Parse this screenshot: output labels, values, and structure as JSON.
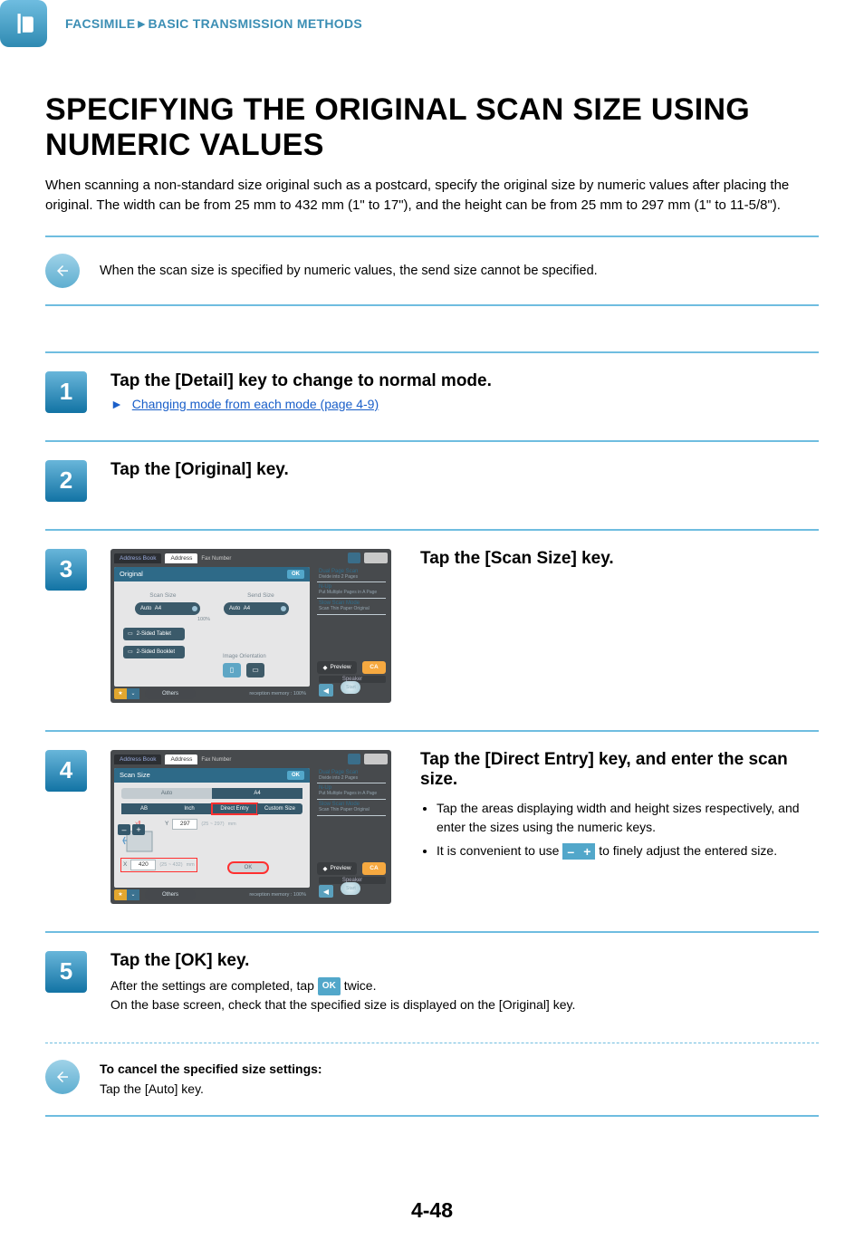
{
  "header": {
    "breadcrumb": "FACSIMILE►BASIC TRANSMISSION METHODS"
  },
  "title": "SPECIFYING THE ORIGINAL SCAN SIZE USING NUMERIC VALUES",
  "intro": "When scanning a non-standard size original such as a postcard, specify the original size by numeric values after placing the original. The width can be from 25 mm to 432 mm (1\" to 17\"), and the height can be from 25 mm to 297 mm (1\" to 11-5/8\").",
  "note": "When the scan size is specified by numeric values, the send size cannot be specified.",
  "steps": {
    "s1": {
      "num": "1",
      "title": "Tap the [Detail] key to change to normal mode.",
      "link": "Changing mode from each mode (page 4-9)"
    },
    "s2": {
      "num": "2",
      "title": "Tap the [Original] key."
    },
    "s3": {
      "num": "3",
      "title": "Tap the [Scan Size] key.",
      "ss": {
        "addressBook": "Address Book",
        "tabAddress": "Address",
        "tabFax": "Fax Number",
        "panelTitle": "Original",
        "ok": "OK",
        "scanSizeLabel": "Scan Size",
        "sendSizeLabel": "Send Size",
        "ratio": "100%",
        "pillAuto": "Auto",
        "pillA4": "A4",
        "twosidedTablet": "2-Sided Tablet",
        "twosidedBooklet": "2-Sided Booklet",
        "imageOrientation": "Image Orientation",
        "others": "Others",
        "receptionMemory": "reception memory :       100%",
        "rp1t": "Dual Page Scan",
        "rp1s": "Divide into 2 Pages",
        "rp2t": "N-Up",
        "rp2s": "Put Multiple Pages in A Page",
        "rp3t": "Slow Scan Mode",
        "rp3s": "Scan Thin Paper Original",
        "preview": "Preview",
        "ca": "CA",
        "speaker": "Speaker",
        "start": "Start"
      }
    },
    "s4": {
      "num": "4",
      "title": "Tap the [Direct Entry] key, and enter the scan size.",
      "bullets": [
        "Tap the areas displaying width and height sizes respectively, and enter the sizes using the numeric keys.",
        "It is convenient to use            to finely adjust the entered size."
      ],
      "ss": {
        "addressBook": "Address Book",
        "tabAddress": "Address",
        "tabFax": "Fax Number",
        "panelTitle": "Scan Size",
        "ok": "OK",
        "tabAuto": "Auto",
        "tabA4": "A4",
        "tabAB": "AB",
        "tabInch": "Inch",
        "tabDirect": "Direct Entry",
        "tabCustom": "Custom Size",
        "yLabel": "Y",
        "yVal": "297",
        "yRange": "(25 ~ 297)",
        "mm": "mm",
        "xLabel": "X",
        "xVal": "420",
        "xRange": "(25 ~ 432)",
        "okBtn": "OK",
        "others": "Others",
        "receptionMemory": "reception memory :       100%",
        "rp1t": "Dual Page Scan",
        "rp1s": "Divide into 2 Pages",
        "rp2t": "N-Up",
        "rp2s": "Put Multiple Pages in A Page",
        "rp3t": "Slow Scan Mode",
        "rp3s": "Scan Thin Paper Original",
        "preview": "Preview",
        "ca": "CA",
        "speaker": "Speaker",
        "start": "Start"
      }
    },
    "s5": {
      "num": "5",
      "title": "Tap the [OK] key.",
      "line_before_ok": "After the settings are completed, tap ",
      "ok_badge": "OK",
      "line_after_ok": " twice.",
      "line2": "On the base screen, check that the specified size is displayed on the [Original] key.",
      "cancel_title": "To cancel the specified size settings:",
      "cancel_body": "Tap the [Auto] key."
    }
  },
  "pageNumber": "4-48",
  "inlineBtns": {
    "minus": "–",
    "plus": "+"
  }
}
